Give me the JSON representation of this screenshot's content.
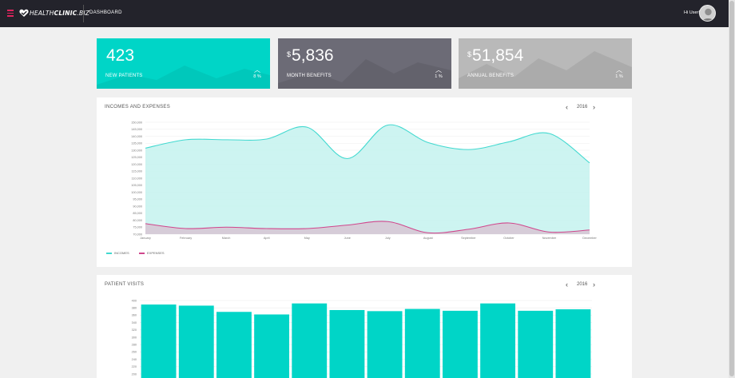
{
  "header": {
    "menu_icon": "hamburger-icon",
    "logo_icon": "heart-check-icon",
    "brand_prefix": "HEALTH",
    "brand_bold": "CLINIC",
    "brand_suffix": ".BIZ",
    "breadcrumb": "DASHBOARD",
    "greeting": "Hi User!",
    "accent": "#e0245e"
  },
  "stats": [
    {
      "value": "423",
      "currency": "",
      "label": "NEW PATIENTS",
      "percent": "8 %",
      "trend_icon": "chevron-up-icon",
      "color": "#00d5c7"
    },
    {
      "value": "5,836",
      "currency": "$",
      "label": "MONTH BENEFITS",
      "percent": "1 %",
      "trend_icon": "chevron-up-icon",
      "color": "#6c6b76"
    },
    {
      "value": "51,854",
      "currency": "$",
      "label": "ANNUAL BENEFITS",
      "percent": "1 %",
      "trend_icon": "chevron-up-icon",
      "color": "#b9b9b9"
    }
  ],
  "incomes_panel": {
    "title": "INCOMES AND EXPENSES",
    "year": "2016",
    "legend": [
      "INCOMES",
      "EXPENSES"
    ]
  },
  "visits_panel": {
    "title": "PATIENT VISITS",
    "year": "2016"
  },
  "chart_data": [
    {
      "type": "area",
      "title": "INCOMES AND EXPENSES",
      "categories": [
        "January",
        "February",
        "March",
        "April",
        "May",
        "June",
        "July",
        "August",
        "September",
        "October",
        "November",
        "December"
      ],
      "y_ticks": [
        "70,000",
        "75,000",
        "80,000",
        "85,000",
        "90,000",
        "95,000",
        "100,000",
        "105,000",
        "110,000",
        "115,000",
        "120,000",
        "125,000",
        "130,000",
        "135,000",
        "140,000",
        "145,000",
        "150,000"
      ],
      "ylim": [
        70000,
        150000
      ],
      "grid": true,
      "legend_position": "bottom-left",
      "series": [
        {
          "name": "INCOMES",
          "color": "#42d9d0",
          "fill": "#c8f3f0",
          "values": [
            131500,
            137500,
            137500,
            138000,
            146500,
            124000,
            148000,
            135500,
            130500,
            136000,
            142000,
            121000
          ]
        },
        {
          "name": "EXPENSES",
          "color": "#d0468c",
          "fill": "#d7c4d4",
          "values": [
            77500,
            74000,
            75000,
            74000,
            74000,
            76500,
            79000,
            71000,
            73500,
            78000,
            71500,
            73000
          ]
        }
      ]
    },
    {
      "type": "bar",
      "title": "PATIENT VISITS",
      "y_ticks": [
        "200",
        "220",
        "240",
        "260",
        "280",
        "300",
        "320",
        "340",
        "360",
        "380",
        "400"
      ],
      "ylim": [
        200,
        400
      ],
      "grid": true,
      "color": "#00d5c7",
      "values": [
        389,
        386,
        369,
        362,
        392,
        374,
        371,
        377,
        372,
        392,
        372,
        376
      ]
    }
  ]
}
